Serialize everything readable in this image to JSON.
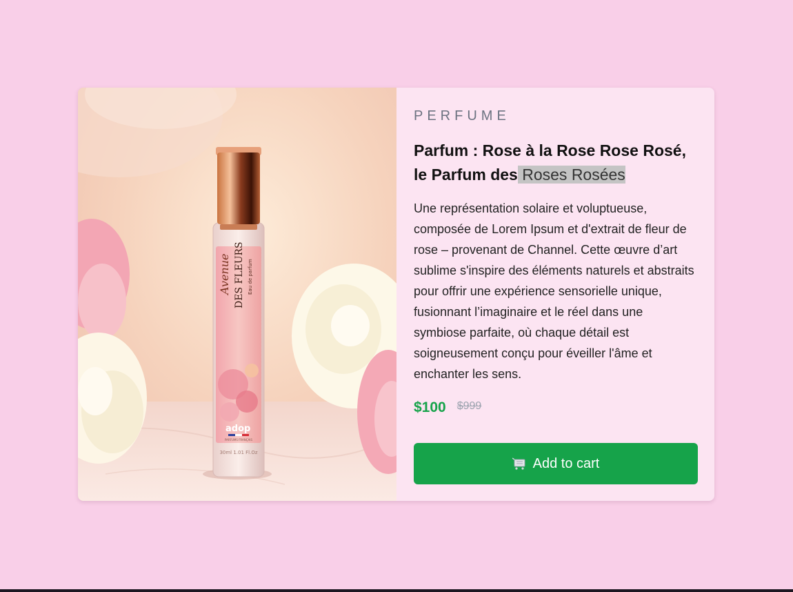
{
  "product": {
    "category": "PERFUME",
    "title_main": "Parfum : Rose à la Rose Rose Rosé, le Parfum des",
    "title_highlight": " Roses Rosées",
    "description": "Une représentation solaire et voluptueuse, composée de Lorem Ipsum et d'extrait de fleur de rose – provenant de Channel. Cette œuvre d’art sublime s'inspire des éléments naturels et abstraits pour offrir une expérience sensorielle unique, fusionnant l’imaginaire et le réel dans une symbiose parfaite, où chaque détail est soigneusement conçu pour éveiller l'âme et enchanter les sens.",
    "price": "$100",
    "old_price": "$999",
    "cart_label": "Add to cart",
    "cart_icon": "shopping-cart-icon"
  },
  "bottle_label": {
    "brand_script": "Avenue",
    "brand_caps": "DES FLEURS",
    "type": "Eau de parfum",
    "maker": "adop",
    "origin": "PARFUMS FRANÇAIS",
    "volume": "30ml 1.01 Fl.Oz"
  },
  "colors": {
    "accent_green": "#16a34a",
    "page_background": "#f9cfe8",
    "card_background": "#fce4f2"
  }
}
